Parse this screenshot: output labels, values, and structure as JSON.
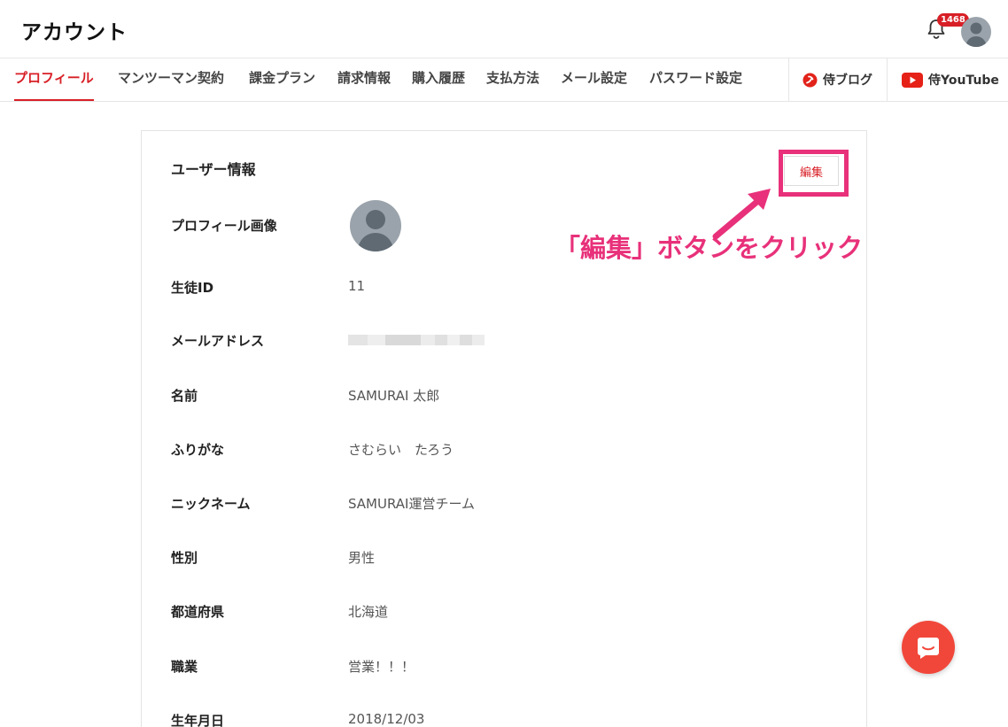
{
  "header": {
    "title": "アカウント",
    "notification_count": "1468"
  },
  "tabs": [
    {
      "label": "プロフィール",
      "active": true
    },
    {
      "label": "マンツーマン契約"
    },
    {
      "label": "課金プラン"
    },
    {
      "label": "請求情報"
    },
    {
      "label": "購入履歴"
    },
    {
      "label": "支払方法"
    },
    {
      "label": "メール設定"
    },
    {
      "label": "パスワード設定"
    }
  ],
  "external_links": [
    {
      "label": "侍ブログ",
      "icon": "samurai-blog-icon"
    },
    {
      "label": "侍YouTube",
      "icon": "youtube-icon"
    }
  ],
  "card": {
    "title": "ユーザー情報",
    "edit_label": "編集",
    "fields": [
      {
        "label": "プロフィール画像",
        "value": ""
      },
      {
        "label": "生徒ID",
        "value": "11"
      },
      {
        "label": "メールアドレス",
        "value": ""
      },
      {
        "label": "名前",
        "value": "SAMURAI 太郎"
      },
      {
        "label": "ふりがな",
        "value": "さむらい　たろう"
      },
      {
        "label": "ニックネーム",
        "value": "SAMURAI運営チーム"
      },
      {
        "label": "性別",
        "value": "男性"
      },
      {
        "label": "都道府県",
        "value": "北海道"
      },
      {
        "label": "職業",
        "value": "営業！！！"
      },
      {
        "label": "生年月日",
        "value": "2018/12/03"
      }
    ]
  },
  "annotation": {
    "text": "「編集」ボタンをクリック"
  },
  "colors": {
    "accent": "#d81f26",
    "annotation": "#e8317a",
    "chat": "#f1473a"
  }
}
